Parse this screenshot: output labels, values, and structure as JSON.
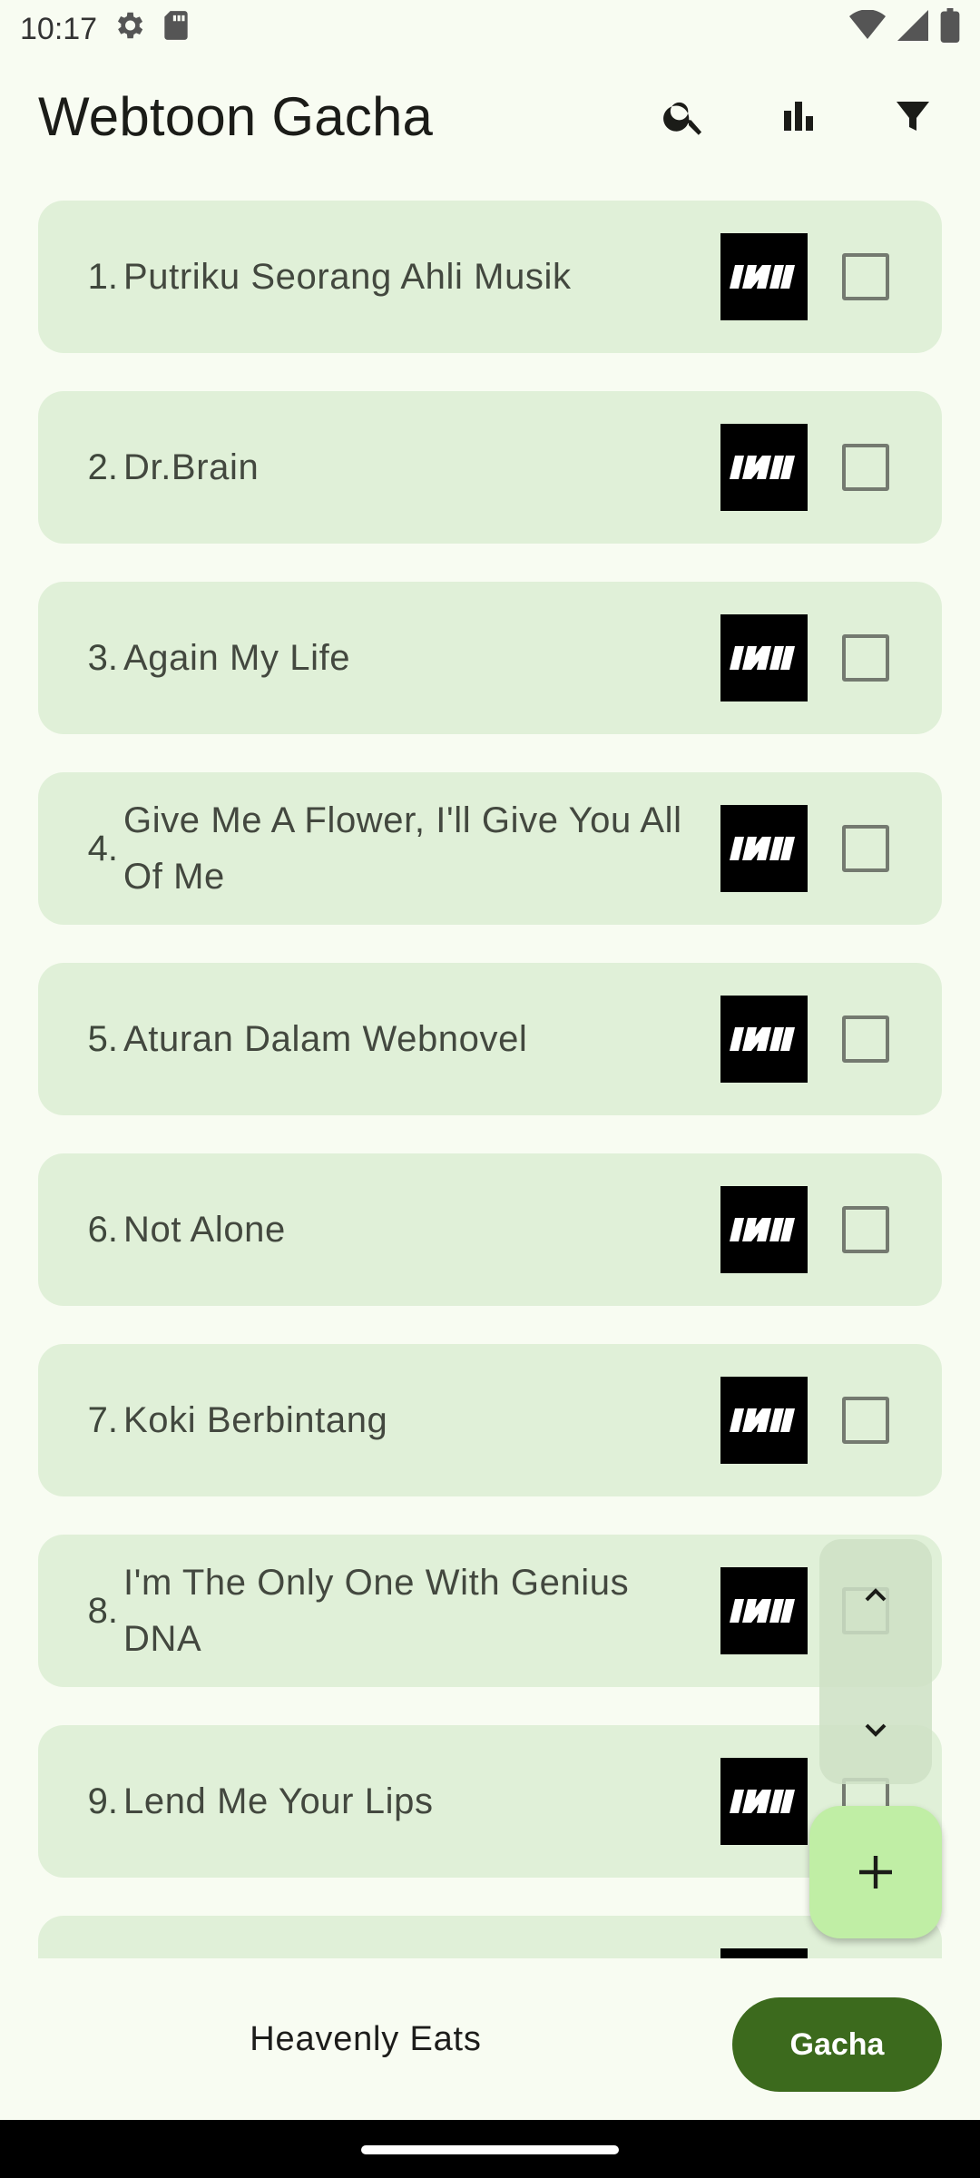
{
  "status_bar": {
    "time": "10:17",
    "icons_left": [
      "settings-icon",
      "sd-card-icon"
    ],
    "icons_right": [
      "wifi-icon",
      "signal-icon",
      "battery-icon"
    ]
  },
  "app_bar": {
    "title": "Webtoon Gacha",
    "actions": [
      "search-icon",
      "bar-chart-icon",
      "filter-icon"
    ]
  },
  "list": {
    "items": [
      {
        "index": "1.",
        "title": "Putriku Seorang Ahli Musik",
        "checked": false
      },
      {
        "index": "2.",
        "title": "Dr.Brain",
        "checked": false
      },
      {
        "index": "3.",
        "title": "Again My Life",
        "checked": false
      },
      {
        "index": "4.",
        "title": "Give Me A Flower, I'll Give You All Of Me",
        "checked": false
      },
      {
        "index": "5.",
        "title": "Aturan Dalam Webnovel",
        "checked": false
      },
      {
        "index": "6.",
        "title": "Not Alone",
        "checked": false
      },
      {
        "index": "7.",
        "title": "Koki Berbintang",
        "checked": false
      },
      {
        "index": "8.",
        "title": "I'm The Only One With Genius DNA",
        "checked": false
      },
      {
        "index": "9.",
        "title": "Lend Me Your Lips",
        "checked": false
      }
    ]
  },
  "bottom_bar": {
    "selected_label": "Heavenly Eats",
    "gacha_label": "Gacha"
  },
  "colors": {
    "background": "#f8fcf2",
    "card": "#e0f0d8",
    "fab": "#c0eea5",
    "primary": "#3c6a1d"
  }
}
